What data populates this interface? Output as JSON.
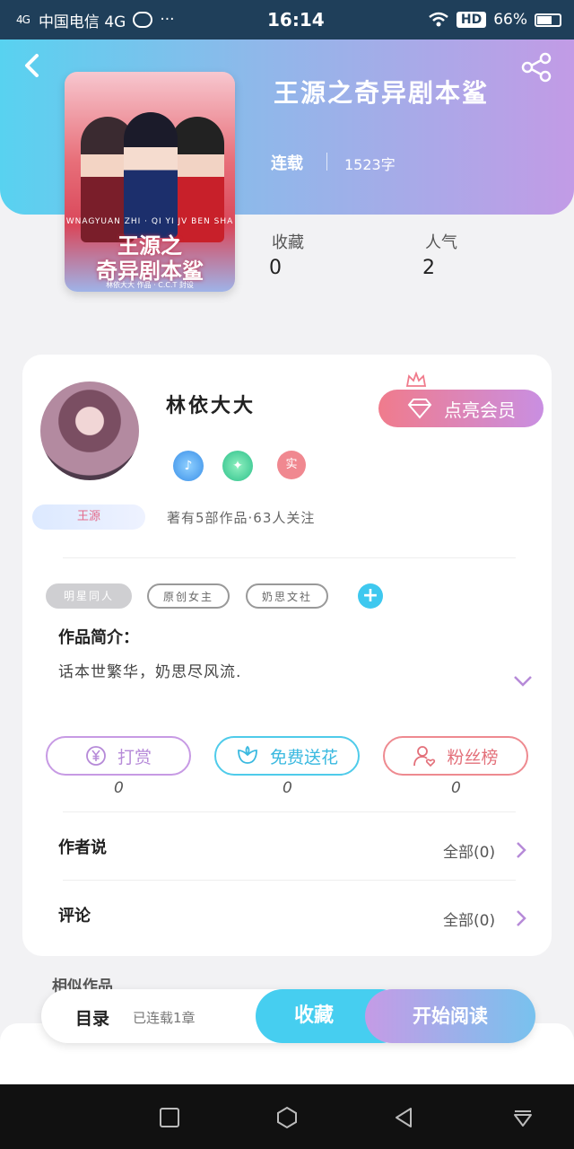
{
  "status_bar": {
    "signal": "4G",
    "carrier": "中国电信 4G",
    "dots": "···",
    "time": "16:14",
    "hd": "HD",
    "battery": "66%"
  },
  "book": {
    "title": "王源之奇异剧本鲨",
    "status": "连载",
    "word_count": "1523字",
    "cover": {
      "title_line1": "王源之",
      "title_line2": "奇异剧本鲨",
      "subtitle": "WNAGYUAN ZHI · QI YI JV BEN SHA",
      "footer": "林依大大 作品 · C.C.T 封设"
    }
  },
  "stats": {
    "favorites_label": "收藏",
    "favorites_value": "0",
    "popularity_label": "人气",
    "popularity_value": "2"
  },
  "author": {
    "name": "林依大大",
    "badge_label": "王源",
    "meta": "著有5部作品·63人关注",
    "vip_button": "点亮会员",
    "badge_real": "实"
  },
  "tags": [
    "明星同人",
    "原创女主",
    "奶思文社"
  ],
  "intro": {
    "label": "作品简介：",
    "text": "话本世繁华，奶思尽风流."
  },
  "actions": {
    "reward_label": "打赏",
    "reward_count": "0",
    "flower_label": "免费送花",
    "flower_count": "0",
    "fans_label": "粉丝榜",
    "fans_count": "0"
  },
  "rows": {
    "author_says_label": "作者说",
    "author_says_right": "全部(0)",
    "comments_label": "评论",
    "comments_right": "全部(0)"
  },
  "similar_label": "相似作品",
  "bottom_bar": {
    "toc_label": "目录",
    "toc_status": "已连载1章",
    "favorite_button": "收藏",
    "read_button": "开始阅读"
  },
  "icons": {
    "back": "back-arrow-icon",
    "share": "share-icon",
    "vip": "diamond-icon",
    "crown": "crown-icon"
  },
  "colors": {
    "header_start": "#58d2f0",
    "header_end": "#c29be6",
    "favorite_button": "#46cef0",
    "reward": "#c79ae4",
    "flower": "#4fcbea",
    "fans": "#ee8a90"
  }
}
